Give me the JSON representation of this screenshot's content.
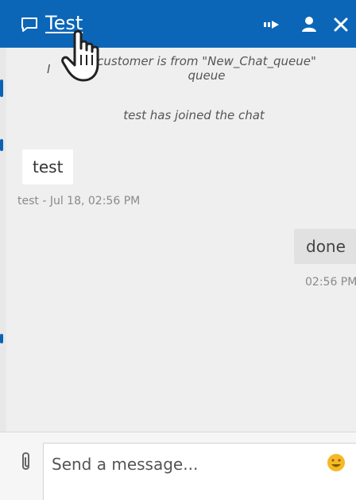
{
  "header": {
    "title": "Test",
    "icons": [
      "chat-icon",
      "transfer-chat-icon",
      "user-icon",
      "close-icon"
    ],
    "background": "#0c66b8"
  },
  "messages": {
    "system": [
      {
        "prefix": "I",
        "text": "customer is from \"New_Chat_queue\" queue"
      },
      {
        "text": "test has joined the chat"
      }
    ],
    "incoming": [
      {
        "text": "test",
        "meta": "test - Jul 18, 02:56 PM"
      }
    ],
    "outgoing": [
      {
        "text": "done",
        "meta": "02:56 PM"
      }
    ]
  },
  "composer": {
    "placeholder": "Send a message...",
    "attach_icon": "paperclip-icon",
    "emoji_icon": "emoji-icon"
  },
  "colors": {
    "accent": "#0c66b8",
    "outgoing_bubble": "#e1e1e1",
    "emoji": "#f5b926"
  }
}
